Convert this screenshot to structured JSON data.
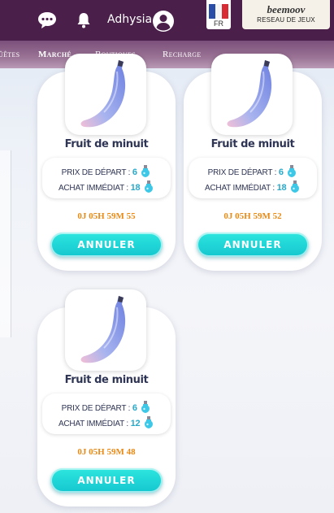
{
  "header": {
    "username": "Adhysia",
    "language_code": "FR",
    "partner": {
      "logo": "beemoov",
      "subtitle": "RESEAU DE JEUX"
    }
  },
  "nav": {
    "items": [
      {
        "label": "ûêtes"
      },
      {
        "label": "Marché"
      },
      {
        "label": "Boutiques"
      },
      {
        "label": "Recharge"
      }
    ]
  },
  "cards": [
    {
      "name": "Fruit de minuit",
      "start_label": "PRIX DE DÉPART :",
      "start_price": "6",
      "buy_label": "ACHAT IMMÉDIAT :",
      "buy_price": "18",
      "timer": "0J 05H 59M 55",
      "button": "ANNULER"
    },
    {
      "name": "Fruit de minuit",
      "start_label": "PRIX DE DÉPART :",
      "start_price": "6",
      "buy_label": "ACHAT IMMÉDIAT :",
      "buy_price": "18",
      "timer": "0J 05H 59M 52",
      "button": "ANNULER"
    },
    {
      "name": "Fruit de minuit",
      "start_label": "PRIX DE DÉPART :",
      "start_price": "6",
      "buy_label": "ACHAT IMMÉDIAT :",
      "buy_price": "12",
      "timer": "0J 05H 59M 48",
      "button": "ANNULER"
    }
  ],
  "colors": {
    "header_bg": "#4a1f4a",
    "price_value": "#2aa9c9",
    "timer": "#e88a17",
    "button": "#1fd6d8"
  },
  "icons": [
    "chat-icon",
    "bell-icon",
    "avatar-icon",
    "flag-icon",
    "banana-icon",
    "potion-icon"
  ]
}
